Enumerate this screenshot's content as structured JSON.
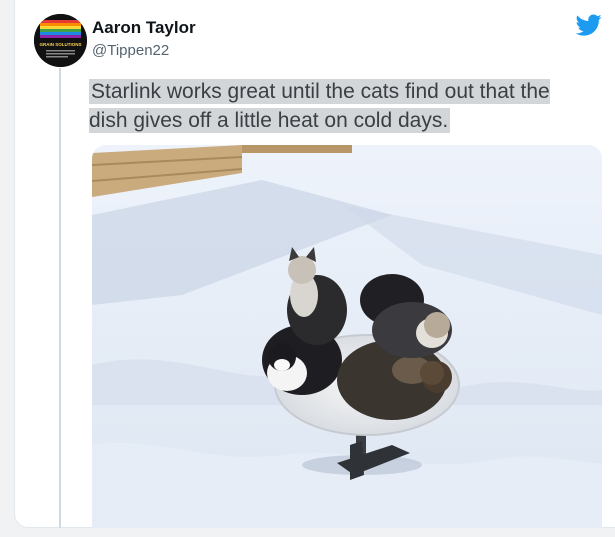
{
  "tweet": {
    "author_name": "Aaron Taylor",
    "author_handle": "@Tippen22",
    "text": "Starlink works great until the cats find out that the dish gives off a little heat on cold days.",
    "avatar_text_top": "GRAIN SOLUTIONS",
    "brand_icon": "twitter-bird-icon"
  },
  "media": {
    "subject": "photo"
  },
  "colors": {
    "twitter_blue": "#1d9bf0",
    "text_highlight": "#d3d6d9"
  }
}
